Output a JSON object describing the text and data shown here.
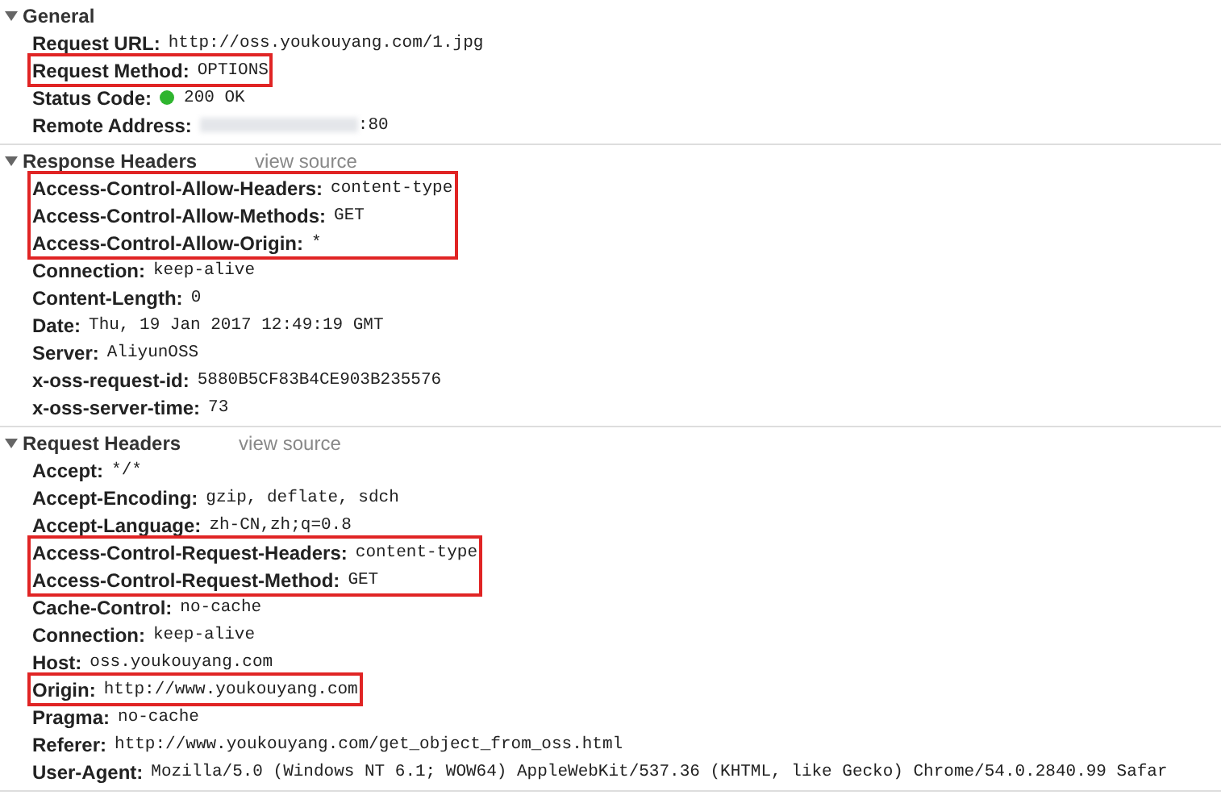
{
  "sections": [
    {
      "title": "General",
      "expanded": true,
      "rows": [
        {
          "kind": "plain",
          "name": "Request URL:",
          "value": "http://oss.youkouyang.com/1.jpg",
          "highlighted": false
        },
        {
          "kind": "plain",
          "name": "Request Method:",
          "value": "OPTIONS",
          "highlighted": true
        },
        {
          "kind": "status",
          "name": "Status Code:",
          "value": "200 OK",
          "color": "#2fb52f",
          "highlighted": false
        },
        {
          "kind": "masked",
          "name": "Remote Address:",
          "value": ":80",
          "highlighted": false
        }
      ]
    },
    {
      "title": "Response Headers",
      "view_source": "view source",
      "expanded": true,
      "rows": [
        {
          "kind": "plain",
          "name": "Access-Control-Allow-Headers:",
          "value": "content-type",
          "highlighted": true
        },
        {
          "kind": "plain",
          "name": "Access-Control-Allow-Methods:",
          "value": "GET",
          "highlighted": true
        },
        {
          "kind": "plain",
          "name": "Access-Control-Allow-Origin:",
          "value": "*",
          "highlighted": true
        },
        {
          "kind": "plain",
          "name": "Connection:",
          "value": "keep-alive",
          "highlighted": false
        },
        {
          "kind": "plain",
          "name": "Content-Length:",
          "value": "0",
          "highlighted": false
        },
        {
          "kind": "plain",
          "name": "Date:",
          "value": "Thu, 19 Jan 2017 12:49:19 GMT",
          "highlighted": false
        },
        {
          "kind": "plain",
          "name": "Server:",
          "value": "AliyunOSS",
          "highlighted": false
        },
        {
          "kind": "plain",
          "name": "x-oss-request-id:",
          "value": "5880B5CF83B4CE903B235576",
          "highlighted": false
        },
        {
          "kind": "plain",
          "name": "x-oss-server-time:",
          "value": "73",
          "highlighted": false
        }
      ]
    },
    {
      "title": "Request Headers",
      "view_source": "view source",
      "expanded": true,
      "rows": [
        {
          "kind": "plain",
          "name": "Accept:",
          "value": "*/*",
          "highlighted": false
        },
        {
          "kind": "plain",
          "name": "Accept-Encoding:",
          "value": "gzip, deflate, sdch",
          "highlighted": false
        },
        {
          "kind": "plain",
          "name": "Accept-Language:",
          "value": "zh-CN,zh;q=0.8",
          "highlighted": false
        },
        {
          "kind": "plain",
          "name": "Access-Control-Request-Headers:",
          "value": "content-type",
          "highlighted": true
        },
        {
          "kind": "plain",
          "name": "Access-Control-Request-Method:",
          "value": "GET",
          "highlighted": true
        },
        {
          "kind": "plain",
          "name": "Cache-Control:",
          "value": "no-cache",
          "highlighted": false
        },
        {
          "kind": "plain",
          "name": "Connection:",
          "value": "keep-alive",
          "highlighted": false
        },
        {
          "kind": "plain",
          "name": "Host:",
          "value": "oss.youkouyang.com",
          "highlighted": false
        },
        {
          "kind": "plain",
          "name": "Origin:",
          "value": "http://www.youkouyang.com",
          "highlighted": true
        },
        {
          "kind": "plain",
          "name": "Pragma:",
          "value": "no-cache",
          "highlighted": false
        },
        {
          "kind": "plain",
          "name": "Referer:",
          "value": "http://www.youkouyang.com/get_object_from_oss.html",
          "highlighted": false
        },
        {
          "kind": "plain",
          "name": "User-Agent:",
          "value": "Mozilla/5.0 (Windows NT 6.1; WOW64) AppleWebKit/537.36 (KHTML, like Gecko) Chrome/54.0.2840.99 Safar",
          "highlighted": false
        }
      ]
    }
  ]
}
